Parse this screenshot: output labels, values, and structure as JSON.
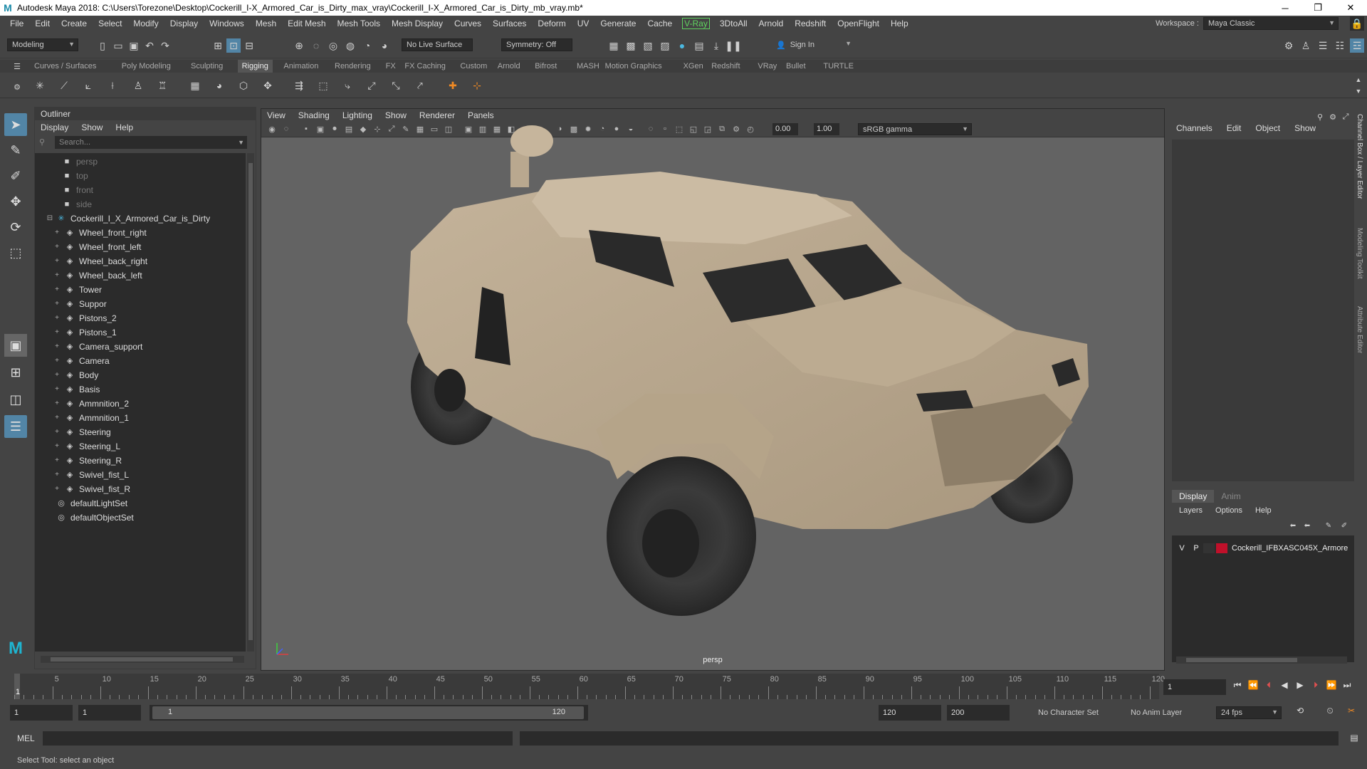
{
  "window": {
    "title": "Autodesk Maya 2018: C:\\Users\\Torezone\\Desktop\\Cockerill_I-X_Armored_Car_is_Dirty_max_vray\\Cockerill_I-X_Armored_Car_is_Dirty_mb_vray.mb*",
    "logo": "M"
  },
  "menubar": {
    "items": [
      "File",
      "Edit",
      "Create",
      "Select",
      "Modify",
      "Display",
      "Windows",
      "Mesh",
      "Edit Mesh",
      "Mesh Tools",
      "Mesh Display",
      "Curves",
      "Surfaces",
      "Deform",
      "UV",
      "Generate",
      "Cache"
    ],
    "vray": "V-Ray",
    "items2": [
      "3DtoAll",
      "Arnold",
      "Redshift",
      "OpenFlight",
      "Help"
    ],
    "workspace_label": "Workspace :",
    "workspace_value": "Maya Classic"
  },
  "statusline": {
    "mode": "Modeling",
    "live_surface": "No Live Surface",
    "symmetry": "Symmetry: Off",
    "sign_in": "Sign In"
  },
  "shelf_tabs": [
    "Curves / Surfaces",
    "Poly Modeling",
    "Sculpting",
    "Rigging",
    "Animation",
    "Rendering",
    "FX",
    "FX Caching",
    "Custom",
    "Arnold",
    "Bifrost",
    "MASH",
    "Motion Graphics",
    "XGen",
    "Redshift",
    "VRay",
    "Bullet",
    "TURTLE"
  ],
  "shelf_active": "Rigging",
  "outliner": {
    "title": "Outliner",
    "menu": [
      "Display",
      "Show",
      "Help"
    ],
    "search_placeholder": "Search...",
    "cameras": [
      "persp",
      "top",
      "front",
      "side"
    ],
    "root": "Cockerill_I_X_Armored_Car_is_Dirty",
    "children": [
      "Wheel_front_right",
      "Wheel_front_left",
      "Wheel_back_right",
      "Wheel_back_left",
      "Tower",
      "Suppor",
      "Pistons_2",
      "Pistons_1",
      "Camera_support",
      "Camera",
      "Body",
      "Basis",
      "Ammnition_2",
      "Ammnition_1",
      "Steering",
      "Steering_L",
      "Steering_R",
      "Swivel_fist_L",
      "Swivel_fist_R"
    ],
    "sets": [
      "defaultLightSet",
      "defaultObjectSet"
    ]
  },
  "viewport": {
    "menu": [
      "View",
      "Shading",
      "Lighting",
      "Show",
      "Renderer",
      "Panels"
    ],
    "exposure": "0.00",
    "gamma": "1.00",
    "colorspace": "sRGB gamma",
    "camera_label": "persp"
  },
  "channelbox": {
    "menu": [
      "Channels",
      "Edit",
      "Object",
      "Show"
    ]
  },
  "layers": {
    "tabs": [
      "Display",
      "Anim"
    ],
    "menu": [
      "Layers",
      "Options",
      "Help"
    ],
    "row": {
      "v": "V",
      "p": "P",
      "name": "Cockerill_IFBXASC045X_Armore",
      "color": "#c0102a"
    }
  },
  "side_tabs": [
    "Channel Box / Layer Editor",
    "Modeling Toolkit",
    "Attribute Editor"
  ],
  "timeline": {
    "ticks": [
      "5",
      "10",
      "15",
      "20",
      "25",
      "30",
      "35",
      "40",
      "45",
      "50",
      "55",
      "60",
      "65",
      "70",
      "75",
      "80",
      "85",
      "90",
      "95",
      "100",
      "105",
      "110",
      "115",
      "120"
    ],
    "current_frame": "1",
    "current_frame_field": "1"
  },
  "range": {
    "start": "1",
    "playback_start": "1",
    "slider_start": "1",
    "slider_end": "120",
    "playback_end": "120",
    "end": "200",
    "character_set": "No Character Set",
    "anim_layer": "No Anim Layer",
    "fps": "24 fps"
  },
  "mel": {
    "label": "MEL"
  },
  "help_line": "Select Tool: select an object"
}
